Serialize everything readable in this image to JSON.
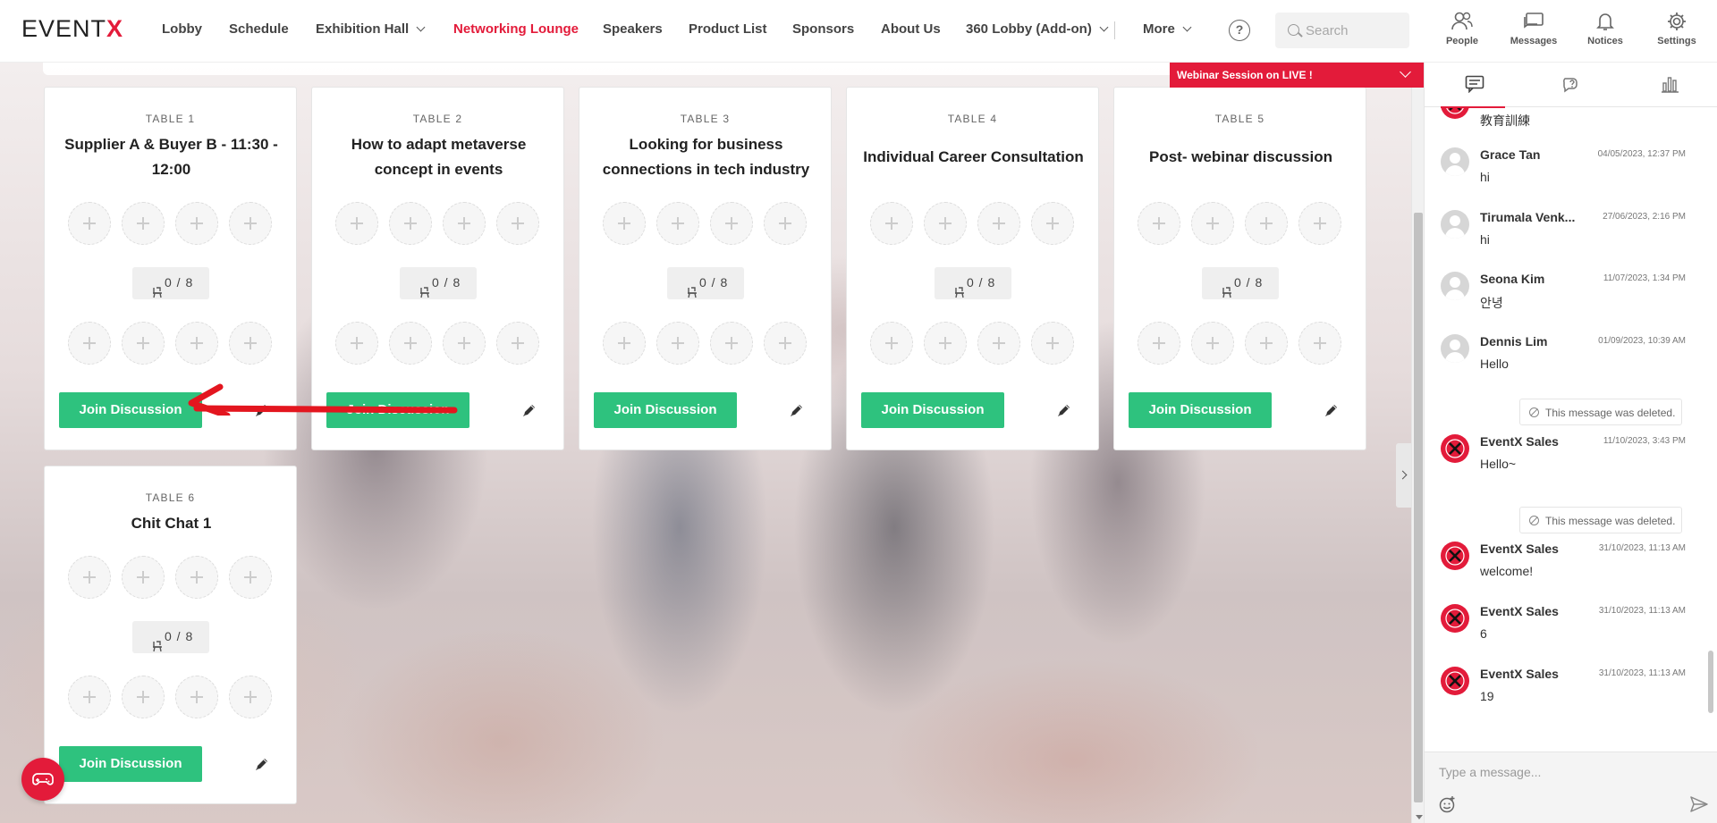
{
  "brand": {
    "logo_text": "EVENT",
    "logo_accent": "X",
    "accent_color": "#e31b3a",
    "join_color": "#2ec27e"
  },
  "nav": {
    "items": [
      {
        "label": "Lobby"
      },
      {
        "label": "Schedule"
      },
      {
        "label": "Exhibition Hall"
      },
      {
        "label": "Networking Lounge",
        "active": true
      },
      {
        "label": "Speakers"
      },
      {
        "label": "Product List"
      },
      {
        "label": "Sponsors"
      },
      {
        "label": "About Us"
      },
      {
        "label": "360 Lobby (Add-on)"
      },
      {
        "label": "More"
      }
    ],
    "search_placeholder": "Search",
    "tools": [
      {
        "label": "People",
        "icon": "people-icon"
      },
      {
        "label": "Messages",
        "icon": "messages-icon"
      },
      {
        "label": "Notices",
        "icon": "bell-icon"
      },
      {
        "label": "Settings",
        "icon": "gear-icon"
      }
    ]
  },
  "webinar_banner": {
    "text": "Webinar Session on LIVE !"
  },
  "tables": [
    {
      "label": "TABLE 1",
      "title": "Supplier A & Buyer B - 11:30 - 12:00",
      "capacity": "0 / 8",
      "join_label": "Join Discussion"
    },
    {
      "label": "TABLE 2",
      "title": "How to adapt metaverse concept in events",
      "capacity": "0 / 8",
      "join_label": "Join Discussion"
    },
    {
      "label": "TABLE 3",
      "title": "Looking for business connections in tech industry",
      "capacity": "0 / 8",
      "join_label": "Join Discussion"
    },
    {
      "label": "TABLE 4",
      "title": "Individual Career Consultation",
      "capacity": "0 / 8",
      "join_label": "Join Discussion"
    },
    {
      "label": "TABLE 5",
      "title": "Post- webinar discussion",
      "capacity": "0 / 8",
      "join_label": "Join Discussion"
    },
    {
      "label": "TABLE 6",
      "title": "Chit Chat 1",
      "capacity": "0 / 8",
      "join_label": "Join Discussion"
    }
  ],
  "chat": {
    "tabs": [
      {
        "icon": "chat-icon",
        "active": true
      },
      {
        "icon": "qa-icon"
      },
      {
        "icon": "poll-icon"
      }
    ],
    "messages": [
      {
        "text": "教育訓練",
        "avatar": "brand"
      },
      {
        "name": "Grace Tan",
        "time": "04/05/2023, 12:37 PM",
        "text": "hi",
        "avatar": "person"
      },
      {
        "name": "Tirumala Venk...",
        "time": "27/06/2023, 2:16 PM",
        "text": "hi",
        "avatar": "person"
      },
      {
        "name": "Seona Kim",
        "time": "11/07/2023, 1:34 PM",
        "text": "안녕",
        "avatar": "person"
      },
      {
        "name": "Dennis Lim",
        "time": "01/09/2023, 10:39 AM",
        "text": "Hello",
        "avatar": "person"
      },
      {
        "deleted": "This message was deleted."
      },
      {
        "name": "EventX Sales",
        "time": "11/10/2023, 3:43 PM",
        "text": "Hello~",
        "avatar": "brand"
      },
      {
        "deleted": "This message was deleted."
      },
      {
        "name": "EventX Sales",
        "time": "31/10/2023, 11:13 AM",
        "text": "welcome!",
        "avatar": "brand"
      },
      {
        "name": "EventX Sales",
        "time": "31/10/2023, 11:13 AM",
        "text": "6",
        "avatar": "brand"
      },
      {
        "name": "EventX Sales",
        "time": "31/10/2023, 11:13 AM",
        "text": "19",
        "avatar": "brand"
      }
    ],
    "compose_placeholder": "Type a message..."
  }
}
